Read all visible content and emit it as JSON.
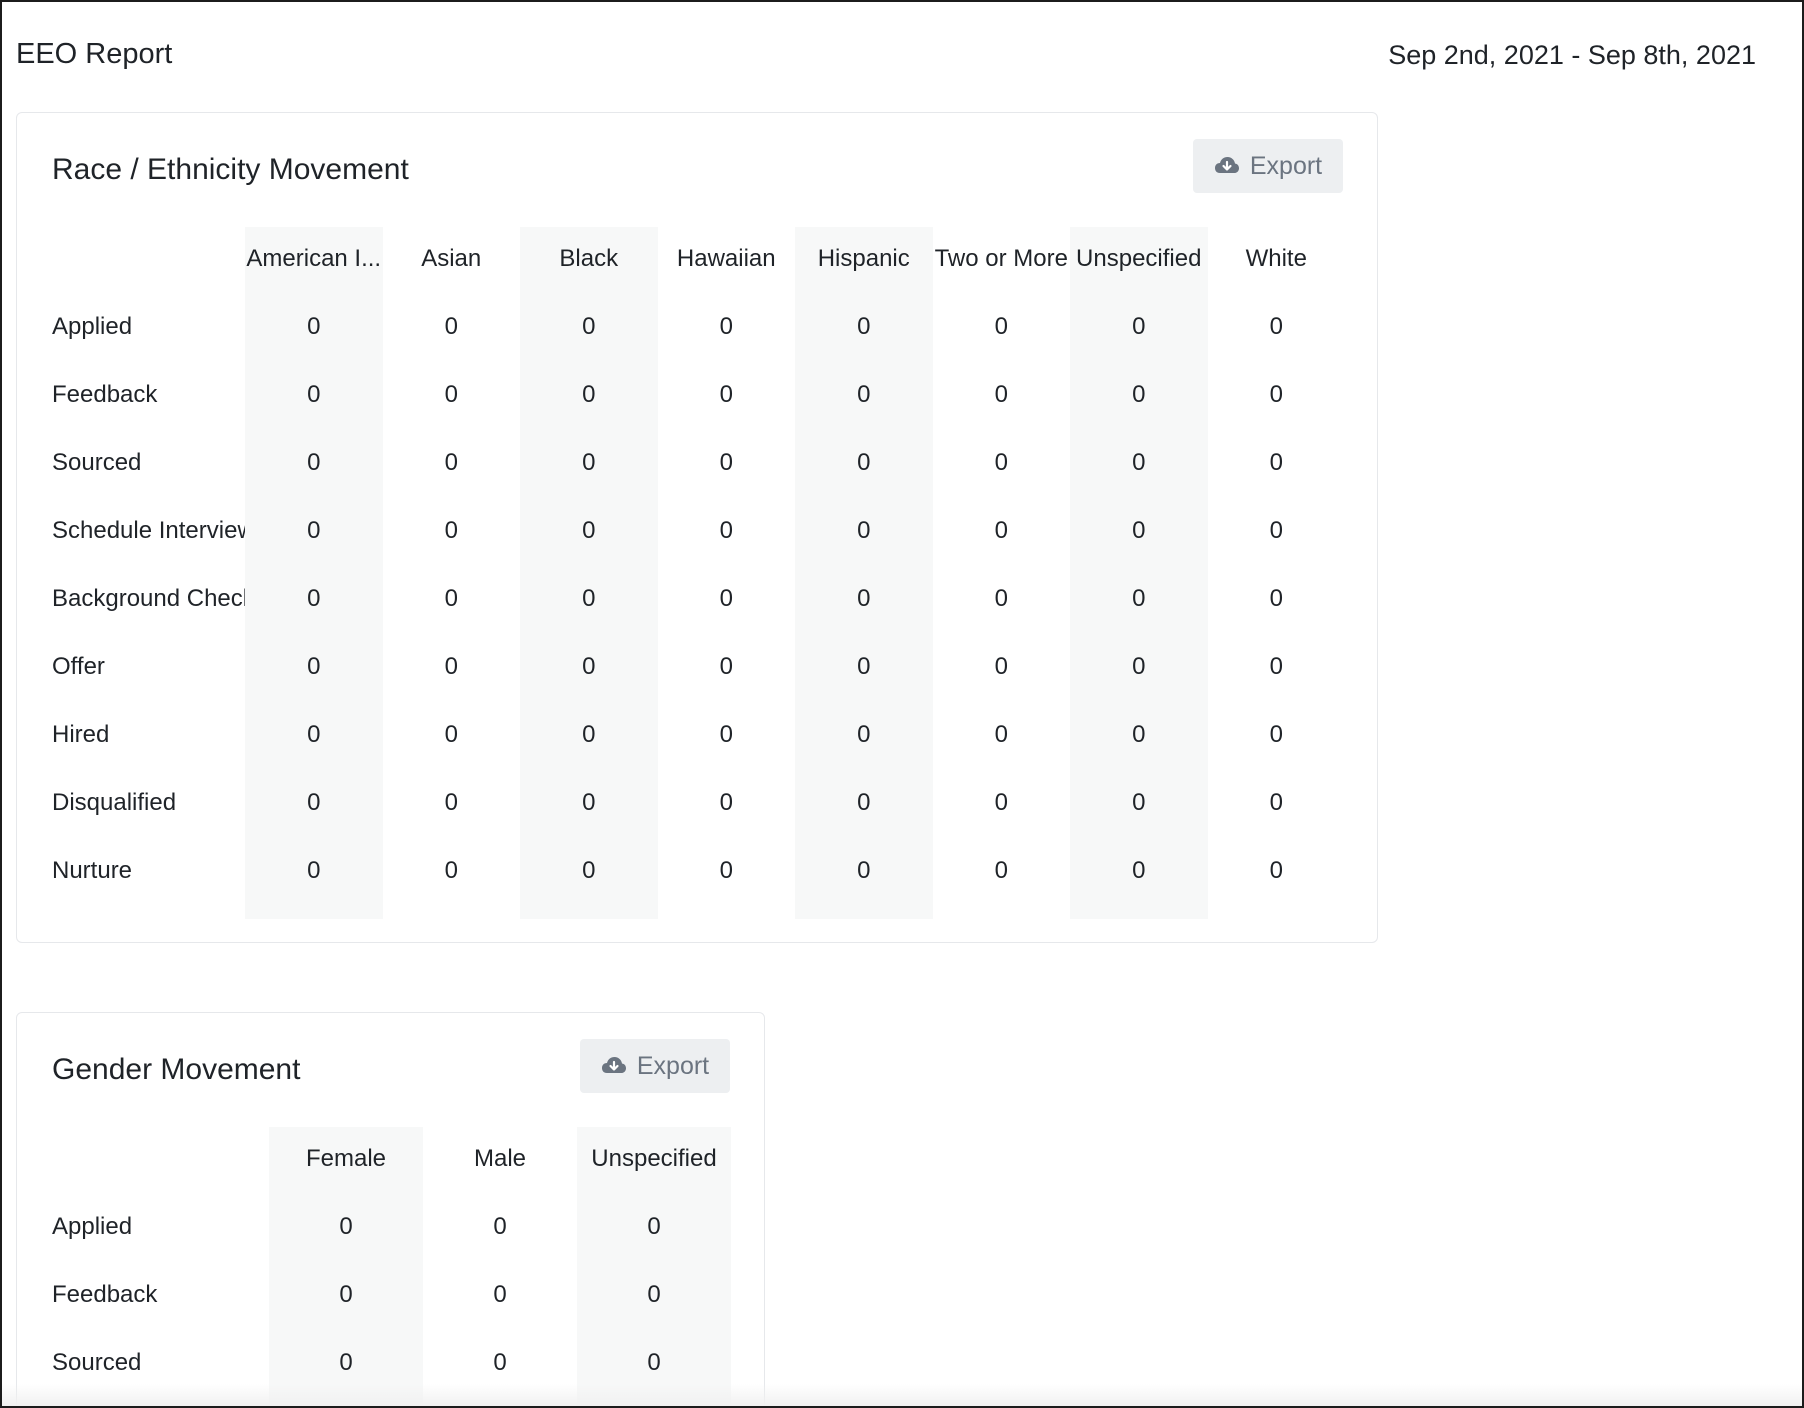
{
  "header": {
    "title": "EEO Report",
    "date_range": "Sep 2nd, 2021 - Sep 8th, 2021"
  },
  "race_card": {
    "title": "Race / Ethnicity Movement",
    "export_label": "Export",
    "columns": [
      "American I...",
      "Asian",
      "Black",
      "Hawaiian",
      "Hispanic",
      "Two or More",
      "Unspecified",
      "White"
    ],
    "rows": [
      {
        "label": "Applied",
        "values": [
          "0",
          "0",
          "0",
          "0",
          "0",
          "0",
          "0",
          "0"
        ]
      },
      {
        "label": "Feedback",
        "values": [
          "0",
          "0",
          "0",
          "0",
          "0",
          "0",
          "0",
          "0"
        ]
      },
      {
        "label": "Sourced",
        "values": [
          "0",
          "0",
          "0",
          "0",
          "0",
          "0",
          "0",
          "0"
        ]
      },
      {
        "label": "Schedule Interview",
        "values": [
          "0",
          "0",
          "0",
          "0",
          "0",
          "0",
          "0",
          "0"
        ]
      },
      {
        "label": "Background Check",
        "values": [
          "0",
          "0",
          "0",
          "0",
          "0",
          "0",
          "0",
          "0"
        ]
      },
      {
        "label": "Offer",
        "values": [
          "0",
          "0",
          "0",
          "0",
          "0",
          "0",
          "0",
          "0"
        ]
      },
      {
        "label": "Hired",
        "values": [
          "0",
          "0",
          "0",
          "0",
          "0",
          "0",
          "0",
          "0"
        ]
      },
      {
        "label": "Disqualified",
        "values": [
          "0",
          "0",
          "0",
          "0",
          "0",
          "0",
          "0",
          "0"
        ]
      },
      {
        "label": "Nurture",
        "values": [
          "0",
          "0",
          "0",
          "0",
          "0",
          "0",
          "0",
          "0"
        ]
      }
    ]
  },
  "gender_card": {
    "title": "Gender Movement",
    "export_label": "Export",
    "columns": [
      "Female",
      "Male",
      "Unspecified"
    ],
    "rows": [
      {
        "label": "Applied",
        "values": [
          "0",
          "0",
          "0"
        ]
      },
      {
        "label": "Feedback",
        "values": [
          "0",
          "0",
          "0"
        ]
      },
      {
        "label": "Sourced",
        "values": [
          "0",
          "0",
          "0"
        ]
      }
    ]
  },
  "icons": {
    "export": "cloud-download-icon"
  }
}
